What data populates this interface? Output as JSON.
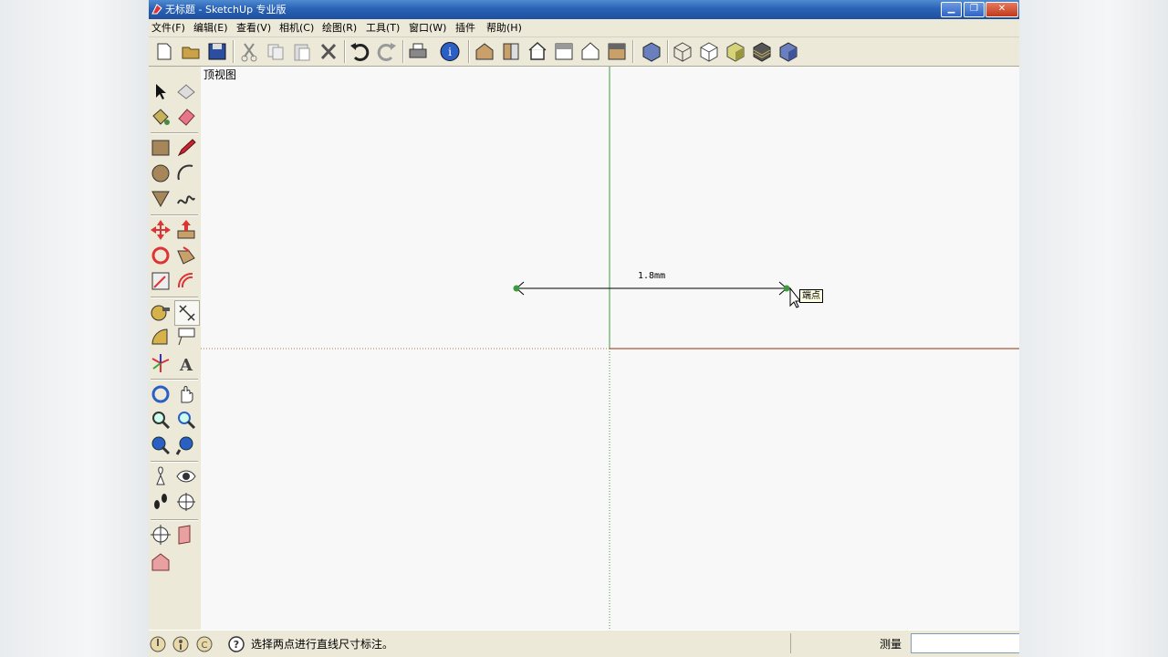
{
  "window": {
    "title": "无标题 - SketchUp 专业版",
    "min_label": "▁",
    "max_label": "❐",
    "close_label": "✕"
  },
  "menu": [
    "文件(F)",
    "编辑(E)",
    "查看(V)",
    "相机(C)",
    "绘图(R)",
    "工具(T)",
    "窗口(W)",
    "插件",
    "帮助(H)"
  ],
  "toolbar_icons": [
    "new-icon",
    "open-icon",
    "save-icon",
    "cut-icon",
    "copy-icon",
    "paste-icon",
    "erase-icon",
    "undo-icon",
    "redo-icon",
    "print-icon",
    "model-info-icon",
    "iso-view-icon",
    "top-view-icon",
    "front-view-icon",
    "right-view-icon",
    "back-view-icon",
    "left-view-icon",
    "xray-icon",
    "wireframe-icon",
    "hidden-line-icon",
    "shaded-icon",
    "shaded-textures-icon",
    "monochrome-icon"
  ],
  "viewport": {
    "view_label": "顶视图",
    "dimension_text": "1.8mm",
    "tooltip": "端点"
  },
  "status": {
    "message": "选择两点进行直线尺寸标注。",
    "measure_label": "测量",
    "measure_value": ""
  },
  "colors": {
    "green_axis": "#3d9b3d",
    "red_axis": "#b4735a",
    "title_blue": "#2a63b6"
  }
}
